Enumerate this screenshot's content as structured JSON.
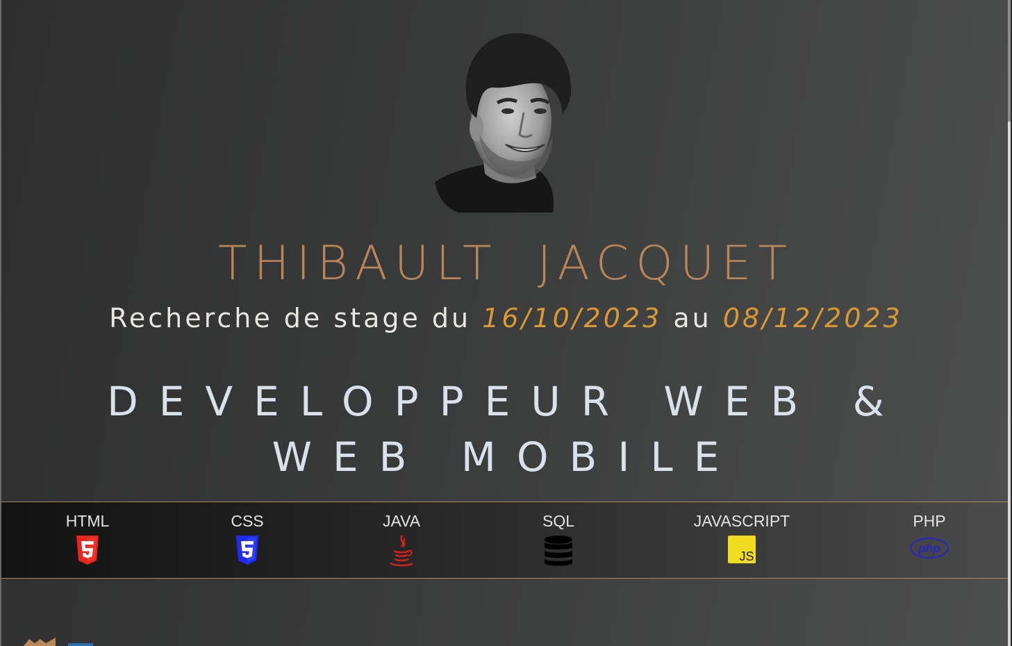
{
  "profile": {
    "first_name": "THIBAULT",
    "last_name": "JACQUET",
    "photo_icon": "portrait-photo"
  },
  "internship": {
    "prefix": "Recherche de stage du",
    "start_date": "16/10/2023",
    "connector": "au",
    "end_date": "08/12/2023"
  },
  "role": {
    "title": "DEVELOPPEUR WEB & WEB MOBILE"
  },
  "skills": [
    {
      "label": "HTML",
      "icon": "html5-icon",
      "color": "#e8261d"
    },
    {
      "label": "CSS",
      "icon": "css3-icon",
      "color": "#1f2bf0"
    },
    {
      "label": "JAVA",
      "icon": "java-icon",
      "color": "#d4241a"
    },
    {
      "label": "SQL",
      "icon": "database-icon",
      "color": "#000000"
    },
    {
      "label": "JAVASCRIPT",
      "icon": "javascript-icon",
      "color": "#f0db1e"
    },
    {
      "label": "PHP",
      "icon": "php-icon",
      "color": "#2424c8"
    }
  ],
  "colors": {
    "name": "#b98659",
    "dates": "#d99a35",
    "role": "#d9e2ea",
    "border": "#b98659"
  }
}
